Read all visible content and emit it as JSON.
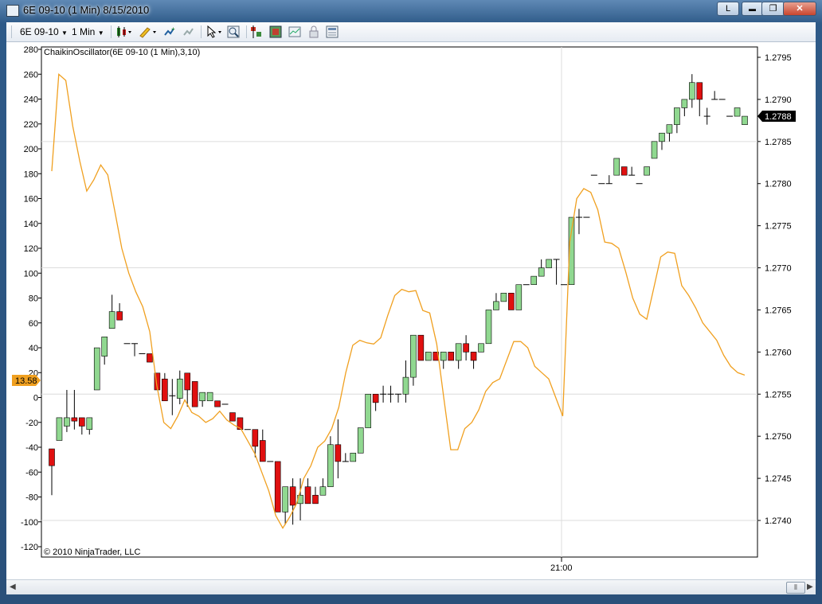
{
  "window": {
    "title": "6E 09-10 (1 Min)  8/15/2010",
    "l_button": "L",
    "minimize": "▬",
    "maximize": "❐",
    "close": "✕"
  },
  "toolbar": {
    "instrument": "6E 09-10",
    "interval": "1 Min",
    "icons": [
      "candlestick-style-icon",
      "pencil-draw-icon",
      "add-indicator-icon",
      "remove-indicator-icon",
      "cursor-select-icon",
      "zoom-icon",
      "data-series-icon",
      "strategy-icon",
      "chart-trader-icon",
      "lock-icon",
      "properties-icon"
    ]
  },
  "chart": {
    "indicator_label": "ChaikinOscillator(6E 09-10 (1 Min),3,10)",
    "copyright": "© 2010 NinjaTrader, LLC",
    "time_label": "21:00",
    "indicator_value_badge": "13.58",
    "price_value_badge": "1.2788",
    "left_axis_ticks": [
      "280",
      "260",
      "240",
      "220",
      "200",
      "180",
      "160",
      "140",
      "120",
      "100",
      "80",
      "60",
      "40",
      "20",
      "0",
      "-20",
      "-40",
      "-60",
      "-80",
      "-100",
      "-120"
    ],
    "right_axis_ticks": [
      "1.2795",
      "1.2790",
      "1.2785",
      "1.2780",
      "1.2775",
      "1.2770",
      "1.2765",
      "1.2760",
      "1.2755",
      "1.2750",
      "1.2745",
      "1.2740"
    ],
    "colors": {
      "up": "#90d890",
      "down": "#e01010",
      "indicator": "#f0a020",
      "wick": "#000000"
    }
  },
  "chart_data": {
    "type": "line",
    "title": "ChaikinOscillator(6E 09-10 (1 Min),3,10)",
    "xlabel": "",
    "ylabel": "",
    "y_left_lim": [
      -120,
      280
    ],
    "y_right_lim": [
      1.2735,
      1.2798
    ],
    "series": [
      {
        "name": "ChaikinOscillator(6E 09-10 (1 Min),3,10)",
        "axis": "left",
        "values": [
          182,
          260,
          255,
          218,
          190,
          166,
          175,
          187,
          179,
          150,
          120,
          100,
          85,
          73,
          53,
          10,
          -20,
          -25,
          -15,
          -2,
          -12,
          -15,
          -20,
          -17,
          -11,
          -18,
          -22,
          -25,
          -35,
          -45,
          -60,
          -75,
          -95,
          -105,
          -96,
          -85,
          -65,
          -55,
          -40,
          -35,
          -25,
          -8,
          20,
          42,
          46,
          44,
          43,
          48,
          66,
          82,
          87,
          85,
          86,
          70,
          68,
          43,
          0,
          -42,
          -42,
          -25,
          -20,
          -10,
          5,
          12,
          15,
          30,
          45,
          45,
          40,
          25,
          20,
          15,
          0,
          -15,
          125,
          160,
          168,
          165,
          151,
          125,
          124,
          120,
          101,
          80,
          67,
          63,
          88,
          113,
          117,
          116,
          90,
          82,
          72,
          60,
          53,
          46,
          34,
          25,
          20,
          18
        ]
      }
    ],
    "candles_note": "price candles (O,H,L,C) on right axis",
    "candles": [
      [
        1.27485,
        1.27485,
        1.2743,
        1.27465
      ],
      [
        1.27495,
        1.27522,
        1.27495,
        1.27522
      ],
      [
        1.27512,
        1.27555,
        1.27505,
        1.27522
      ],
      [
        1.27522,
        1.27555,
        1.27508,
        1.27518
      ],
      [
        1.27522,
        1.27522,
        1.27502,
        1.27512
      ],
      [
        1.27508,
        1.27522,
        1.27502,
        1.27522
      ],
      [
        1.27555,
        1.27605,
        1.27555,
        1.27605
      ],
      [
        1.27595,
        1.27618,
        1.27585,
        1.27618
      ],
      [
        1.27628,
        1.27668,
        1.27628,
        1.27648
      ],
      [
        1.27648,
        1.27658,
        1.27638,
        1.27638
      ],
      [
        1.2761,
        1.2761,
        1.2761,
        1.2761
      ],
      [
        1.2761,
        1.2761,
        1.27595,
        1.2761
      ],
      [
        1.27598,
        1.27598,
        1.27598,
        1.27598
      ],
      [
        1.27598,
        1.27598,
        1.27588,
        1.27588
      ],
      [
        1.27575,
        1.27575,
        1.27555,
        1.27555
      ],
      [
        1.27568,
        1.27575,
        1.27542,
        1.27542
      ],
      [
        1.27548,
        1.27568,
        1.27525,
        1.27548
      ],
      [
        1.27545,
        1.27578,
        1.27538,
        1.27568
      ],
      [
        1.27575,
        1.27575,
        1.27535,
        1.27555
      ],
      [
        1.27565,
        1.27565,
        1.27535,
        1.27535
      ],
      [
        1.27542,
        1.27552,
        1.27535,
        1.27552
      ],
      [
        1.27542,
        1.27552,
        1.27542,
        1.27552
      ],
      [
        1.27542,
        1.27542,
        1.27535,
        1.27535
      ],
      [
        1.27538,
        1.27538,
        1.27538,
        1.27538
      ],
      [
        1.27528,
        1.27528,
        1.27518,
        1.27518
      ],
      [
        1.27522,
        1.27522,
        1.27508,
        1.27508
      ],
      [
        1.27508,
        1.27508,
        1.27508,
        1.27508
      ],
      [
        1.27508,
        1.27508,
        1.27475,
        1.27488
      ],
      [
        1.27495,
        1.27508,
        1.2747,
        1.2747
      ],
      [
        1.2747,
        1.2747,
        1.2747,
        1.2747
      ],
      [
        1.2747,
        1.2747,
        1.2741,
        1.2741
      ],
      [
        1.2741,
        1.27438,
        1.27395,
        1.2744
      ],
      [
        1.2744,
        1.2745,
        1.27395,
        1.27418
      ],
      [
        1.2742,
        1.2745,
        1.274,
        1.2743
      ],
      [
        1.2744,
        1.2745,
        1.2742,
        1.2742
      ],
      [
        1.2743,
        1.2744,
        1.2742,
        1.2742
      ],
      [
        1.2743,
        1.2745,
        1.2743,
        1.2744
      ],
      [
        1.2744,
        1.275,
        1.2744,
        1.2749
      ],
      [
        1.2749,
        1.2752,
        1.2745,
        1.2747
      ],
      [
        1.2747,
        1.2748,
        1.2747,
        1.2747
      ],
      [
        1.2747,
        1.2748,
        1.2747,
        1.2748
      ],
      [
        1.2748,
        1.2751,
        1.2748,
        1.2751
      ],
      [
        1.2751,
        1.2755,
        1.2751,
        1.2755
      ],
      [
        1.2755,
        1.2755,
        1.2753,
        1.2754
      ],
      [
        1.2755,
        1.2756,
        1.2754,
        1.2755
      ],
      [
        1.2755,
        1.2756,
        1.2754,
        1.2755
      ],
      [
        1.2755,
        1.2755,
        1.2754,
        1.2755
      ],
      [
        1.2755,
        1.2759,
        1.2754,
        1.2757
      ],
      [
        1.2757,
        1.2762,
        1.2756,
        1.2762
      ],
      [
        1.2762,
        1.2762,
        1.2759,
        1.2759
      ],
      [
        1.2759,
        1.276,
        1.2759,
        1.276
      ],
      [
        1.276,
        1.276,
        1.2759,
        1.2759
      ],
      [
        1.2759,
        1.276,
        1.2758,
        1.276
      ],
      [
        1.276,
        1.276,
        1.2759,
        1.2759
      ],
      [
        1.2759,
        1.2761,
        1.2758,
        1.2761
      ],
      [
        1.2761,
        1.2762,
        1.2759,
        1.276
      ],
      [
        1.276,
        1.276,
        1.2758,
        1.2759
      ],
      [
        1.276,
        1.2761,
        1.276,
        1.2761
      ],
      [
        1.2761,
        1.2765,
        1.2761,
        1.2765
      ],
      [
        1.2765,
        1.2767,
        1.2765,
        1.2766
      ],
      [
        1.2766,
        1.2767,
        1.2766,
        1.2767
      ],
      [
        1.2767,
        1.2767,
        1.2766,
        1.2765
      ],
      [
        1.2765,
        1.2768,
        1.2765,
        1.2768
      ],
      [
        1.2768,
        1.2768,
        1.2768,
        1.2768
      ],
      [
        1.2768,
        1.2769,
        1.2768,
        1.2769
      ],
      [
        1.2769,
        1.2771,
        1.2769,
        1.277
      ],
      [
        1.277,
        1.2771,
        1.277,
        1.2771
      ],
      [
        1.2771,
        1.2771,
        1.2768,
        1.2771
      ],
      [
        1.2768,
        1.2768,
        1.2768,
        1.2768
      ],
      [
        1.2768,
        1.2776,
        1.2768,
        1.2776
      ],
      [
        1.2776,
        1.2777,
        1.2774,
        1.2776
      ],
      [
        1.2776,
        1.2776,
        1.2776,
        1.2776
      ],
      [
        1.2781,
        1.2781,
        1.2781,
        1.2781
      ],
      [
        1.278,
        1.278,
        1.278,
        1.278
      ],
      [
        1.278,
        1.2781,
        1.278,
        1.278
      ],
      [
        1.2781,
        1.2783,
        1.2781,
        1.2783
      ],
      [
        1.2782,
        1.2782,
        1.2781,
        1.2781
      ],
      [
        1.2781,
        1.2782,
        1.2781,
        1.2781
      ],
      [
        1.278,
        1.278,
        1.278,
        1.278
      ],
      [
        1.2781,
        1.2782,
        1.2781,
        1.2782
      ],
      [
        1.2783,
        1.2785,
        1.2783,
        1.2785
      ],
      [
        1.2785,
        1.2786,
        1.2784,
        1.2786
      ],
      [
        1.2786,
        1.2787,
        1.2785,
        1.2787
      ],
      [
        1.2787,
        1.2789,
        1.2786,
        1.2789
      ],
      [
        1.2789,
        1.279,
        1.2788,
        1.279
      ],
      [
        1.279,
        1.2793,
        1.2789,
        1.2792
      ],
      [
        1.2792,
        1.2792,
        1.2788,
        1.279
      ],
      [
        1.2788,
        1.2789,
        1.2787,
        1.2788
      ],
      [
        1.279,
        1.2791,
        1.279,
        1.279
      ],
      [
        1.279,
        1.279,
        1.279,
        1.279
      ],
      [
        1.2788,
        1.2788,
        1.2788,
        1.2788
      ],
      [
        1.2788,
        1.2789,
        1.2788,
        1.2789
      ],
      [
        1.2787,
        1.2788,
        1.2787,
        1.2788
      ]
    ]
  }
}
